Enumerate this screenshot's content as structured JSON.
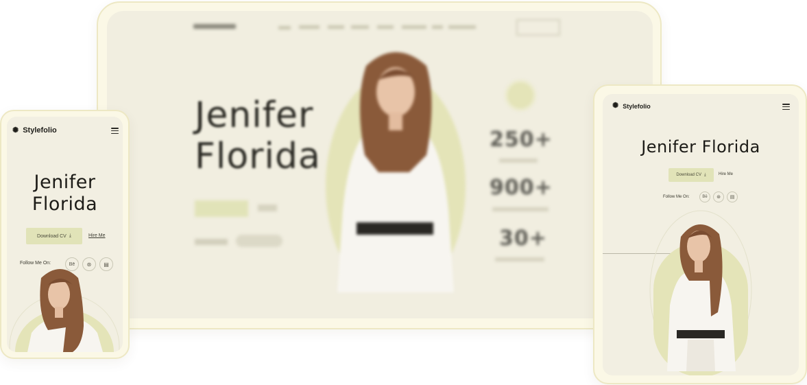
{
  "laptop": {
    "name_line1": "Jenifer",
    "name_line2": "Florida",
    "stats": [
      {
        "value": "250+"
      },
      {
        "value": "900+"
      },
      {
        "value": "30+"
      }
    ]
  },
  "mobile": {
    "brand": "Stylefolio",
    "name_line1": "Jenifer",
    "name_line2": "Florida",
    "download_label": "Download CV",
    "hire_label": "Hire Me",
    "follow_label": "Follow Me On:",
    "socials": [
      {
        "label": "Bē",
        "icon": "behance-icon"
      },
      {
        "label": "⊛",
        "icon": "dribbble-icon"
      },
      {
        "label": "▤",
        "icon": "portfolio-icon"
      }
    ]
  },
  "tablet": {
    "brand": "Stylefolio",
    "name": "Jenifer Florida",
    "download_label": "Download CV",
    "hire_label": "Hire Me",
    "follow_label": "Follow Me On:",
    "socials": [
      {
        "label": "Bē",
        "icon": "behance-icon"
      },
      {
        "label": "⊛",
        "icon": "dribbble-icon"
      },
      {
        "label": "▤",
        "icon": "portfolio-icon"
      }
    ]
  },
  "colors": {
    "accent": "#e1e3b8",
    "background": "#f2efe2",
    "frame": "#fbf8e6"
  }
}
